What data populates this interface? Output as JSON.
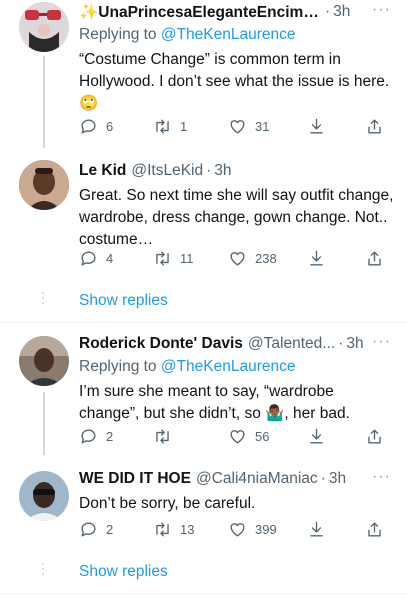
{
  "tweets": [
    {
      "name": "✨UnaPrincesaEleganteEncimaS...",
      "handle": "",
      "time": "3h",
      "replying_prefix": "Replying to ",
      "replying_to": "@TheKenLaurence",
      "text": "“Costume Change” is common term in Hollywood. I don’t see what the issue is here. 🙄",
      "replies": "6",
      "retweets": "1",
      "likes": "31"
    },
    {
      "name": "Le Kid",
      "handle": "@ItsLeKid",
      "time": "3h",
      "text": "Great. So next time she will say outfit change, wardrobe, dress change, gown change. Not.. costume…",
      "replies": "4",
      "retweets": "11",
      "likes": "238"
    },
    {
      "name": "Roderick Donte' Davis",
      "handle": "@Talented...",
      "time": "3h",
      "replying_prefix": "Replying to ",
      "replying_to": "@TheKenLaurence",
      "text": "I’m sure she meant to say, “wardrobe change”, but she didn’t, so 🤷🏾‍♂️, her bad.",
      "replies": "2",
      "retweets": "",
      "likes": "56"
    },
    {
      "name": "WE DID IT HOE",
      "handle": "@Cali4niaManiac",
      "time": "3h",
      "text": "Don’t be sorry, be careful.",
      "replies": "2",
      "retweets": "13",
      "likes": "399"
    }
  ],
  "separator": "·",
  "more_label": "···",
  "show_replies_label": "Show replies",
  "icons": [
    "reply-icon",
    "retweet-icon",
    "like-icon",
    "download-icon",
    "share-icon",
    "more-icon"
  ],
  "colors": {
    "link": "#1d9bf0",
    "muted": "#536471",
    "text": "#0f1419",
    "line": "#cfd9de"
  }
}
